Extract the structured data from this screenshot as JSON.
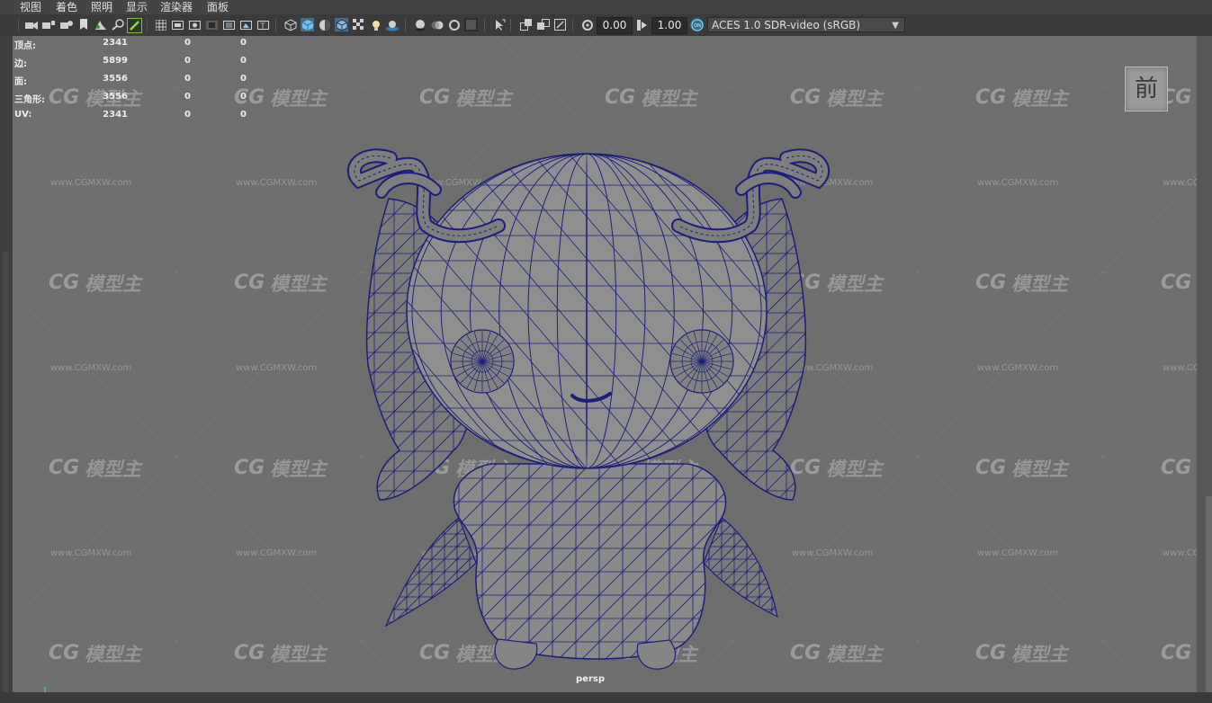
{
  "menubar": {
    "items": [
      "视图",
      "着色",
      "照明",
      "显示",
      "渲染器",
      "面板"
    ]
  },
  "toolbar": {
    "exposure_value": "0.00",
    "gamma_value": "1.00",
    "colorspace_label": "ACES 1.0 SDR-video (sRGB)",
    "icons": [
      "camera-select-icon",
      "camera-attributes-icon",
      "camera-bookmark-icon",
      "bookmark-icon",
      "image-plane-icon",
      "2d-pan-zoom-icon",
      "grease-pencil-icon",
      "grid-icon",
      "film-gate-icon",
      "resolution-gate-icon",
      "gate-mask-icon",
      "field-chart-icon",
      "safe-action-icon",
      "safe-title-icon",
      "wireframe-icon",
      "smooth-shade-icon",
      "default-material-icon",
      "wireframe-on-shaded-icon",
      "textured-icon",
      "use-lights-icon",
      "shadows-icon",
      "screen-ao-icon",
      "motion-blur-icon",
      "anti-alias-icon",
      "depth-of-field-icon",
      "isolate-select-icon",
      "xray-icon",
      "xray-joints-icon",
      "xray-components-icon",
      "exposure-icon",
      "gamma-icon",
      "color-management-icon"
    ]
  },
  "colors": {
    "viewport_bg": "#6e6e6e",
    "wireframe": "#1c1e7a",
    "mesh_fill": "#8a8a8a",
    "toolbar_bg": "#3b3b3b",
    "accent_blue": "#4aa3d8"
  },
  "heads_up": {
    "rows": [
      {
        "label": "顶点:",
        "v1": "2341",
        "v2": "0",
        "v3": "0"
      },
      {
        "label": "边:",
        "v1": "5899",
        "v2": "0",
        "v3": "0"
      },
      {
        "label": "面:",
        "v1": "3556",
        "v2": "0",
        "v3": "0"
      },
      {
        "label": "三角形:",
        "v1": "3556",
        "v2": "0",
        "v3": "0"
      },
      {
        "label": "UV:",
        "v1": "2341",
        "v2": "0",
        "v3": "0"
      }
    ]
  },
  "viewport": {
    "camera_label": "persp",
    "view_cube_label": "前"
  },
  "watermark": {
    "brand": "模型主",
    "url": "www.CGMXW.com"
  }
}
